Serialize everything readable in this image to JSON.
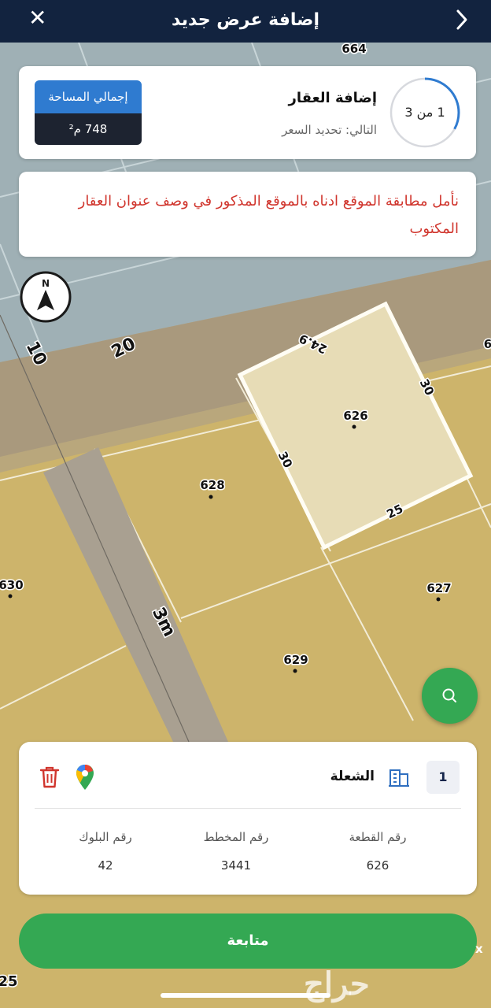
{
  "header": {
    "title": "إضافة عرض جديد"
  },
  "step": {
    "progress": "1 من 3",
    "progress_fraction": 0.33,
    "title": "إضافة العقار",
    "next": "التالي: تحديد السعر"
  },
  "area": {
    "label": "إجمالي المساحة",
    "value": "748 م²"
  },
  "note": {
    "text": "نأمل مطابقة الموقع ادناه بالموقع المذكور في وصف عنوان العقار المكتوب"
  },
  "map": {
    "streets": [
      "10",
      "20",
      "3m"
    ],
    "parcels": [
      "664",
      "626",
      "628",
      "630",
      "627",
      "629"
    ],
    "parcel_partial": "6",
    "dims": [
      "24.9",
      "30",
      "30",
      "25"
    ],
    "edge_number": "25",
    "compass_letter": "N"
  },
  "info": {
    "index": "1",
    "district": "الشعلة",
    "fields": [
      {
        "label": "رقم القطعة",
        "value": "626"
      },
      {
        "label": "رقم المخطط",
        "value": "3441"
      },
      {
        "label": "رقم البلوك",
        "value": "42"
      }
    ]
  },
  "actions": {
    "continue": "متابعة",
    "close_glyph": "✕",
    "small_x": "x"
  },
  "watermark": "حراج",
  "colors": {
    "header": "#12233f",
    "accent_green": "#34a853",
    "area_label": "#2f7bd0",
    "note_red": "#d0352d",
    "selected_parcel": "#e7dcb6"
  }
}
